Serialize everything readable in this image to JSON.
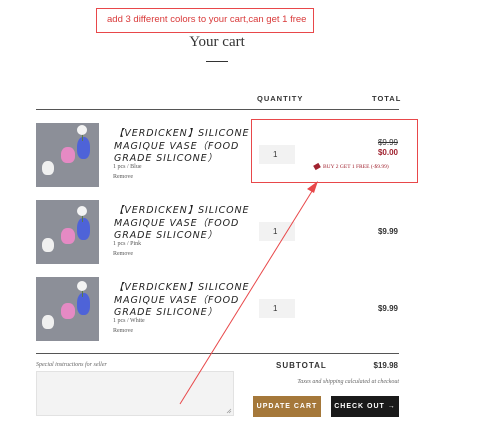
{
  "annotation": {
    "note": "add 3 different colors to your cart,can get 1 free"
  },
  "cart": {
    "title": "Your cart",
    "columns": {
      "quantity": "QUANTITY",
      "total": "TOTAL"
    },
    "items": [
      {
        "name": "【VERDICKEN】SILICONE MAGIQUE VASE（FOOD GRADE SILICONE）",
        "variant": "1 pcs / Blue",
        "remove": "Remove",
        "quantity": "1",
        "original_price": "$9.99",
        "price": "$0.00",
        "promo": "BUY 2 GET 1 FREE (-$9.99)"
      },
      {
        "name": "【VERDICKEN】SILICONE MAGIQUE VASE（FOOD GRADE SILICONE）",
        "variant": "1 pcs / Pink",
        "remove": "Remove",
        "quantity": "1",
        "price": "$9.99"
      },
      {
        "name": "【VERDICKEN】SILICONE MAGIQUE VASE（FOOD GRADE SILICONE）",
        "variant": "1 pcs / White",
        "remove": "Remove",
        "quantity": "1",
        "price": "$9.99"
      }
    ],
    "instructions_label": "Special instructions for seller",
    "subtotal_label": "SUBTOTAL",
    "subtotal_value": "$19.98",
    "tax_note": "Taxes and shipping calculated at checkout",
    "update_label": "UPDATE CART",
    "checkout_label": "CHECK OUT →"
  },
  "colors": {
    "annotation_red": "#e8484a",
    "sale_red": "#a0222f",
    "update_button": "#a5783a",
    "checkout_button": "#1a1a1a"
  },
  "icons": [
    "promo-tag-icon",
    "arrow-right-icon",
    "resize-handle-icon"
  ]
}
